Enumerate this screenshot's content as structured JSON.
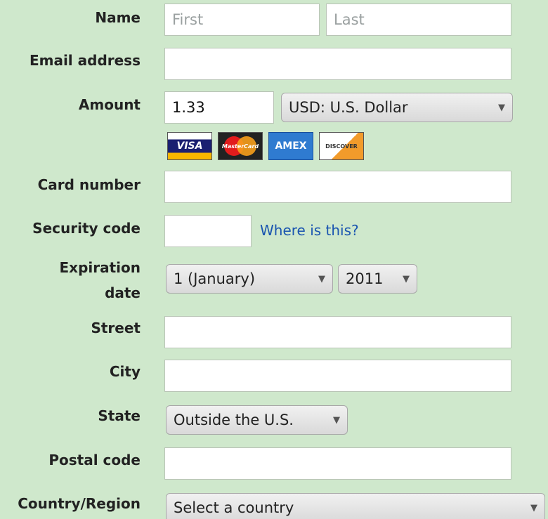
{
  "labels": {
    "name": "Name",
    "email": "Email address",
    "amount": "Amount",
    "card_number": "Card number",
    "security_code": "Security code",
    "expiration_line1": "Expiration",
    "expiration_line2": "date",
    "street": "Street",
    "city": "City",
    "state": "State",
    "postal_code": "Postal code",
    "country": "Country/Region"
  },
  "fields": {
    "first_name": {
      "value": "",
      "placeholder": "First"
    },
    "last_name": {
      "value": "",
      "placeholder": "Last"
    },
    "email": {
      "value": "",
      "placeholder": ""
    },
    "amount": {
      "value": "1.33"
    },
    "card_number": {
      "value": ""
    },
    "security_code": {
      "value": ""
    },
    "street": {
      "value": ""
    },
    "city": {
      "value": ""
    },
    "postal_code": {
      "value": ""
    }
  },
  "selects": {
    "currency": "USD: U.S. Dollar",
    "exp_month": "1 (January)",
    "exp_year": "2011",
    "state": "Outside the U.S.",
    "country": "Select a country"
  },
  "cards": {
    "visa": "VISA",
    "mastercard": "MasterCard",
    "amex": "AMEX",
    "discover": "DISCOVER"
  },
  "security_help_link": "Where is this?",
  "caret_glyph": "▼"
}
